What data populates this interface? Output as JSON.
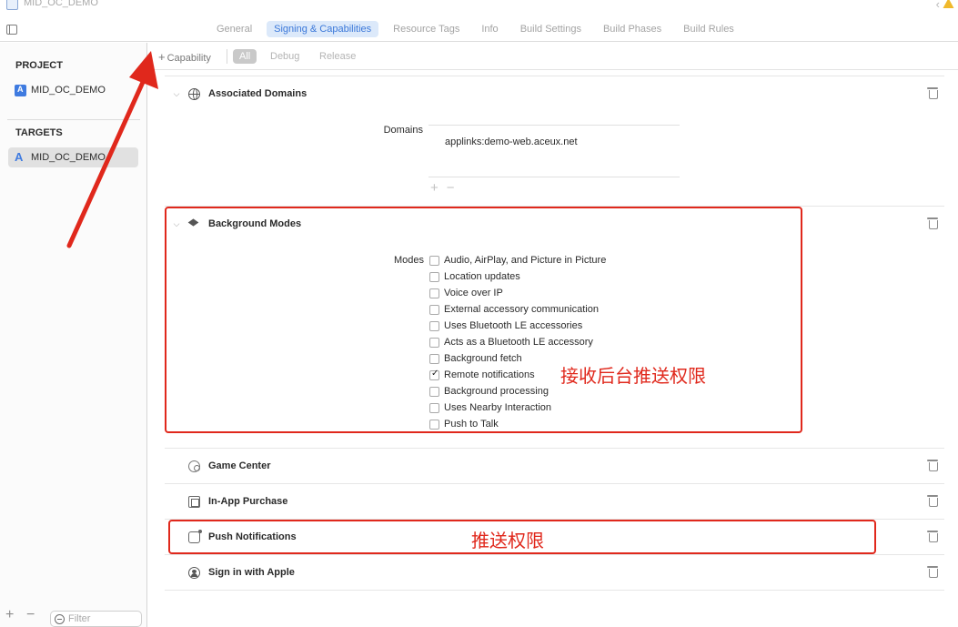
{
  "window": {
    "title": "MID_OC_DEMO"
  },
  "tabs": [
    {
      "label": "General",
      "active": false
    },
    {
      "label": "Signing & Capabilities",
      "active": true
    },
    {
      "label": "Resource Tags",
      "active": false
    },
    {
      "label": "Info",
      "active": false
    },
    {
      "label": "Build Settings",
      "active": false
    },
    {
      "label": "Build Phases",
      "active": false
    },
    {
      "label": "Build Rules",
      "active": false
    }
  ],
  "sidebar": {
    "project_heading": "PROJECT",
    "project_item": "MID_OC_DEMO",
    "targets_heading": "TARGETS",
    "target_item": "MID_OC_DEMO",
    "filter_placeholder": "Filter"
  },
  "toolbar": {
    "add_capability": "Capability",
    "filters": [
      "All",
      "Debug",
      "Release"
    ],
    "active_filter": "All"
  },
  "associated_domains": {
    "title": "Associated Domains",
    "field_label": "Domains",
    "domains": [
      "applinks:demo-web.aceux.net"
    ]
  },
  "background_modes": {
    "title": "Background Modes",
    "field_label": "Modes",
    "modes": [
      {
        "label": "Audio, AirPlay, and Picture in Picture",
        "checked": false
      },
      {
        "label": "Location updates",
        "checked": false
      },
      {
        "label": "Voice over IP",
        "checked": false
      },
      {
        "label": "External accessory communication",
        "checked": false
      },
      {
        "label": "Uses Bluetooth LE accessories",
        "checked": false
      },
      {
        "label": "Acts as a Bluetooth LE accessory",
        "checked": false
      },
      {
        "label": "Background fetch",
        "checked": false
      },
      {
        "label": "Remote notifications",
        "checked": true
      },
      {
        "label": "Background processing",
        "checked": false
      },
      {
        "label": "Uses Nearby Interaction",
        "checked": false
      },
      {
        "label": "Push to Talk",
        "checked": false
      }
    ]
  },
  "capabilities": [
    {
      "title": "Game Center",
      "icon": "game-center-icon"
    },
    {
      "title": "In-App Purchase",
      "icon": "in-app-purchase-icon"
    },
    {
      "title": "Push Notifications",
      "icon": "push-notifications-icon"
    },
    {
      "title": "Sign in with Apple",
      "icon": "apple-id-icon"
    }
  ],
  "annotations": {
    "remote_notifications_note": "接收后台推送权限",
    "push_note": "推送权限",
    "color": "#e0281c"
  }
}
